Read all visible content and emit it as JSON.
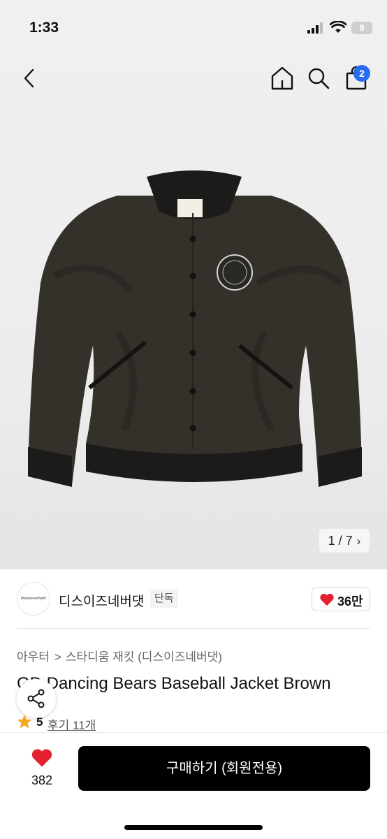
{
  "status_bar": {
    "time": "1:33",
    "battery": "9"
  },
  "nav": {
    "cart_count": "2"
  },
  "gallery": {
    "pager": "1 / 7"
  },
  "brand": {
    "name": "디스이즈네버댓",
    "tag": "단독",
    "logo_text": "thisisneverthat®",
    "likes": "36만"
  },
  "breadcrumb": [
    "아우터",
    "스타디움 재킷 (디스이즈네버댓)"
  ],
  "product": {
    "title": "GD Dancing Bears Baseball Jacket Brown",
    "rating": "5",
    "reviews": "후기 11개"
  },
  "bottom": {
    "wish_count": "382",
    "buy_label": "구매하기 (회원전용)"
  },
  "colors": {
    "accent": "#2a6cf0",
    "heart": "#e5212f",
    "star": "#f5a623",
    "buy_bg": "#000000"
  }
}
